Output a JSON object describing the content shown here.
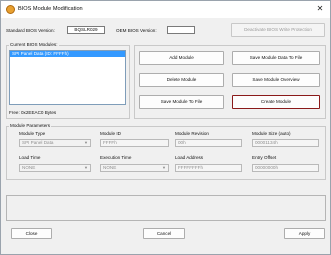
{
  "window": {
    "title": "BIOS Module Modification",
    "close_glyph": "✕"
  },
  "versions": {
    "standard_label": "Standard BIOS Version:",
    "standard_value": "BQSLR029",
    "oem_label": "OEM BIOS Version:",
    "oem_value": "",
    "deactivate_label": "Deactivate BIOS Write Protection"
  },
  "modules": {
    "group_title": "Current BIOS Modules:",
    "items": [
      "SPI Panel Data (ID: FFFFh)"
    ],
    "free_text": "Free: 0x2EEAC0 Bytes"
  },
  "actions": {
    "add": "Add Module",
    "save_data": "Save Module Data To File",
    "delete": "Delete Module",
    "save_overview": "Save Module Overview",
    "save_to_file": "Save Module To File",
    "create": "Create Module"
  },
  "params": {
    "group_title": "Module Parameters",
    "module_type_label": "Module Type",
    "module_type_value": "SPI Panel Data",
    "module_id_label": "Module ID",
    "module_id_value": "FFFFh",
    "module_revision_label": "Module Revision",
    "module_revision_value": "00h",
    "module_size_label": "Module Size (auto)",
    "module_size_value": "00001134h",
    "load_time_label": "Load Time",
    "load_time_value": "NONE",
    "exec_time_label": "Execution Time",
    "exec_time_value": "NONE",
    "load_address_label": "Load Address",
    "load_address_value": "FFFFFFFFh",
    "entry_offset_label": "Entry Offset",
    "entry_offset_value": "00000000h"
  },
  "footer": {
    "close": "Close",
    "cancel": "Cancel",
    "apply": "Apply"
  },
  "colors": {
    "selection": "#3399ff",
    "focus_border": "#8a1a1a",
    "title_icon": "#e8a030"
  },
  "icons": {
    "title": "bios-gear-icon",
    "dropdown": "chevron-down-icon"
  }
}
